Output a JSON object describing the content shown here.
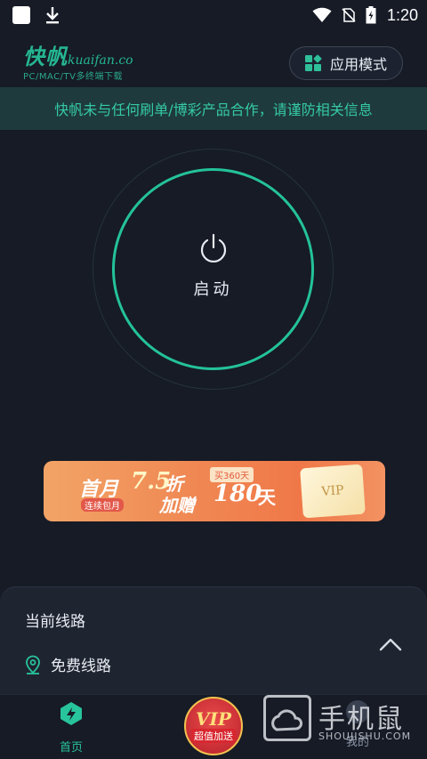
{
  "status_bar": {
    "time": "1:20",
    "icons": [
      "notification-square-icon",
      "download-icon",
      "wifi-icon",
      "no-sim-icon",
      "battery-charging-icon"
    ]
  },
  "header": {
    "logo_cn": "快帆",
    "logo_en": "kuaifan.co",
    "logo_sub": "PC/MAC/TV多终端下载",
    "mode_button_label": "应用模式"
  },
  "notice": {
    "text": "快帆未与任何刷单/博彩产品合作，请谨防相关信息"
  },
  "power": {
    "label": "启动"
  },
  "banner": {
    "first_month": "首月",
    "monthly": "连续包月",
    "discount": "7.5",
    "zhe": "折",
    "bonus": "加赠",
    "buy_tag": "买360天",
    "days": "180",
    "tian": "天",
    "vip": "VIP"
  },
  "route_sheet": {
    "title": "当前线路",
    "route_name": "免费线路"
  },
  "nav": {
    "home_label": "首页",
    "vip_text": "VIP",
    "vip_sub": "超值加送",
    "mine_label": "我的"
  },
  "watermark": {
    "cn": "手机鼠",
    "en": "SHOUJISHU.COM"
  },
  "colors": {
    "accent": "#24c29a",
    "background": "#161b26",
    "notice_bg": "#1e3a3c"
  }
}
